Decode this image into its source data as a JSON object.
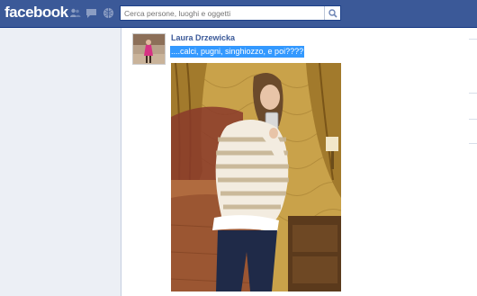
{
  "header": {
    "logo_text": "facebook",
    "bar_color": "#3b5998",
    "icons": [
      "friends-icon",
      "messages-icon",
      "notifications-icon"
    ],
    "search": {
      "placeholder": "Cerca persone, luoghi e oggetti",
      "button_icon": "search-icon"
    }
  },
  "post": {
    "author": "Laura Drzewicka",
    "caption": "....calci, pugni, singhiozzo, e poi????",
    "caption_highlight": "#3399ff",
    "author_color": "#3b5998"
  }
}
